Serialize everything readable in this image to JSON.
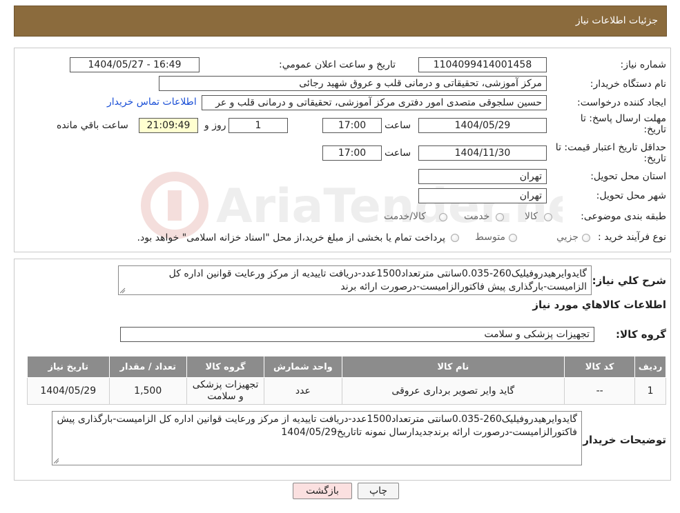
{
  "header": {
    "title": "جزئیات اطلاعات نیاز"
  },
  "watermark": {
    "text": "AriaTender.neT"
  },
  "form": {
    "need_number_label": "شماره نیاز:",
    "need_number": "1104099414001458",
    "announce_label": "تاريخ و ساعت اعلان عمومي:",
    "announce_value": "1404/05/27 - 16:49",
    "buyer_label": "نام دستگاه خريدار:",
    "buyer_value": "مرکز آموزشی، تحقیقاتی و درمانی قلب و عروق شهید رجائی",
    "requester_label": "ايجاد کننده درخواست:",
    "requester_value": "حسین سلجوقی متصدی امور دفتری مرکز آموزشی، تحقیقاتی و درمانی قلب و عر",
    "contact_link": "اطلاعات تماس خريدار",
    "deadline_label_1": "مهلت ارسال پاسخ: تا",
    "deadline_label_2": "تاريخ:",
    "deadline_date": "1404/05/29",
    "time_label": "ساعت",
    "deadline_time": "17:00",
    "days_value": "1",
    "days_label": "روز و",
    "remaining_time": "21:09:49",
    "remaining_label": "ساعت باقي مانده",
    "validity_label_1": "حداقل تاريخ اعتبار قيمت: تا",
    "validity_label_2": "تاريخ:",
    "validity_date": "1404/11/30",
    "validity_time": "17:00",
    "province_label": "استان محل تحويل:",
    "province_value": "تهران",
    "city_label": "شهر محل تحويل:",
    "city_value": "تهران",
    "category_label": "طبقه بندی موضوعی:",
    "category_options": [
      "کالا",
      "خدمت",
      "کالا/خدمت"
    ],
    "process_label": "نوع فرآيند خريد :",
    "process_options": [
      "جزيي",
      "متوسط"
    ],
    "process_note": "پرداخت تمام يا بخشی از مبلغ خريد،از محل \"اسناد خزانه اسلامی\" خواهد بود."
  },
  "summary": {
    "label": "شرح کلي نياز:",
    "text": "گایدوایرهیدروفیلیک260-0.035سانتی مترتعداد1500عدد-دریافت تاییدیه از مرکز ورعایت قوانین اداره کل الزامیست-بارگذاری پیش فاکتورالزامیست-درصورت ارائه برند"
  },
  "goods": {
    "section_title": "اطلاعات کالاهاي مورد نياز",
    "group_label": "گروه کالا:",
    "group_value": "تجهیزات پزشکی و سلامت",
    "columns": [
      "رديف",
      "کد کالا",
      "نام کالا",
      "واحد شمارش",
      "گروه کالا",
      "تعداد / مقدار",
      "تاريخ نياز"
    ],
    "rows": [
      [
        "1",
        "--",
        "گاید وایر تصویر برداری عروقی",
        "عدد",
        "تجهیزات پزشکی و سلامت",
        "1,500",
        "1404/05/29"
      ]
    ]
  },
  "buyer_notes": {
    "label": "توضيحات خريدار:",
    "text": "گایدوایرهیدروفیلیک260-0.035سانتی مترتعداد1500عدد-دریافت تاییدیه از مرکز ورعایت قوانین اداره کل الزامیست-بارگذاری پیش فاکتورالزامیست-درصورت ارائه برندجدیدارسال نمونه تاتاریخ1404/05/29"
  },
  "buttons": {
    "print": "چاپ",
    "back": "بازگشت"
  }
}
